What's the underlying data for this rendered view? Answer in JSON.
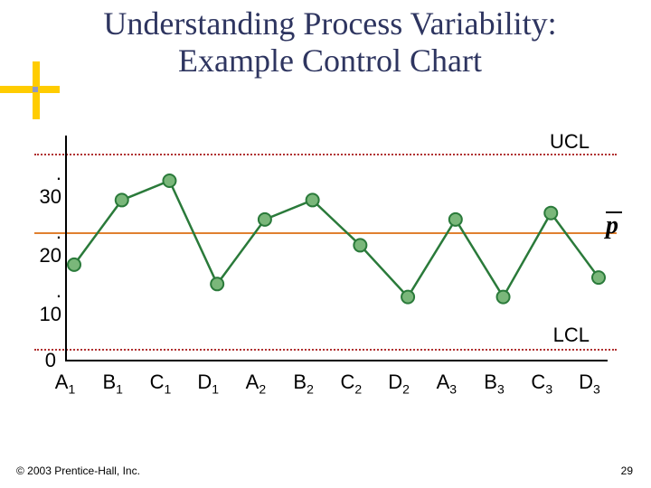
{
  "title_line1": "Understanding Process Variability:",
  "title_line2": "Example Control Chart",
  "labels": {
    "ucl": "UCL",
    "lcl": "LCL",
    "pbar": "p"
  },
  "y_ticks": [
    ". 30",
    ". 20",
    ". 10",
    "0"
  ],
  "x_categories": [
    "A1",
    "B1",
    "C1",
    "D1",
    "A2",
    "B2",
    "C2",
    "D2",
    "A3",
    "B3",
    "C3",
    "D3"
  ],
  "footer": {
    "copyright": "© 2003 Prentice-Hall, Inc.",
    "page": "29"
  },
  "chart_data": {
    "type": "line",
    "title": "Understanding Process Variability: Example Control Chart",
    "xlabel": "",
    "ylabel": "",
    "ylim": [
      0,
      0.35
    ],
    "grid": false,
    "centerline_p_bar": 0.2,
    "ucl": 0.35,
    "lcl": 0.02,
    "categories": [
      "A1",
      "B1",
      "C1",
      "D1",
      "A2",
      "B2",
      "C2",
      "D2",
      "A3",
      "B3",
      "C3",
      "D3"
    ],
    "series": [
      {
        "name": "p",
        "values": [
          0.15,
          0.25,
          0.28,
          0.12,
          0.22,
          0.25,
          0.18,
          0.1,
          0.22,
          0.1,
          0.23,
          0.13
        ]
      }
    ],
    "annotations": [
      "UCL",
      "LCL",
      "p̄"
    ]
  }
}
